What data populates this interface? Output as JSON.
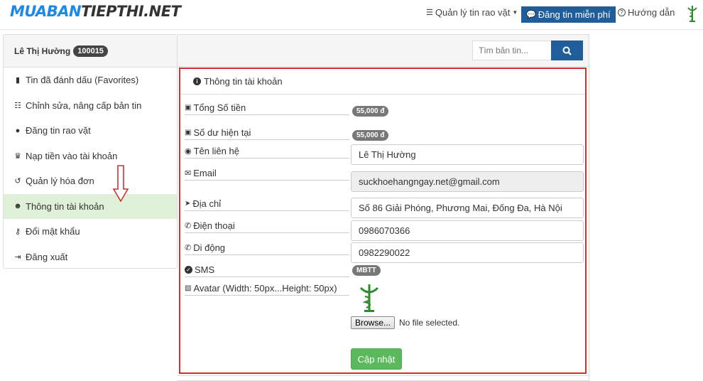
{
  "header": {
    "logo_part1": "MUABAN",
    "logo_part2": "TIEPTHI.NET",
    "nav_manage": "Quản lý tin rao vặt",
    "nav_post": "Đăng tin miễn phí",
    "nav_help": "Hướng dẫn"
  },
  "sidebar": {
    "user_name": "Lê Thị Hường",
    "user_id": "100015",
    "items": [
      {
        "label": "Tin đã đánh dấu (Favorites)",
        "icon": "bookmark-icon"
      },
      {
        "label": "Chỉnh sửa, nâng cấp bản tin",
        "icon": "list-icon"
      },
      {
        "label": "Đăng tin rao vặt",
        "icon": "comment-icon"
      },
      {
        "label": "Nạp tiền vào tài khoản",
        "icon": "trophy-icon"
      },
      {
        "label": "Quản lý hóa đơn",
        "icon": "history-icon"
      },
      {
        "label": "Thông tin tài khoản",
        "icon": "user-icon"
      },
      {
        "label": "Đổi mật khẩu",
        "icon": "key-icon"
      },
      {
        "label": "Đăng xuất",
        "icon": "sign-out-icon"
      }
    ],
    "active_index": 5
  },
  "search": {
    "placeholder": "Tìm bản tin..."
  },
  "panel": {
    "title": "Thông tin tài khoản",
    "total_label": "Tổng Số tiền",
    "total_value": "55,000 đ",
    "balance_label": "Số dư hiện tại",
    "balance_value": "55,000 đ",
    "contact_label": "Tên liên hệ",
    "contact_value": "Lê Thị Hường",
    "email_label": "Email",
    "email_value": "suckhoehangngay.net@gmail.com",
    "address_label": "Địa chỉ",
    "address_value": "Số 86 Giải Phóng, Phương Mai, Đống Đa, Hà Nội",
    "phone_label": "Điện thoại",
    "phone_value": "0986070366",
    "mobile_label": "Di động",
    "mobile_value": "0982290022",
    "sms_label": "SMS",
    "sms_value": "MBTT",
    "avatar_label": "Avatar (Width: 50px...Height: 50px)",
    "browse_label": "Browse...",
    "no_file": "No file selected.",
    "update_label": "Cập nhật"
  },
  "colors": {
    "brand_blue": "#1f5e9a",
    "highlight_red": "#d32f2f",
    "success_green": "#5cb85c",
    "active_item_bg": "#dff0d8"
  }
}
